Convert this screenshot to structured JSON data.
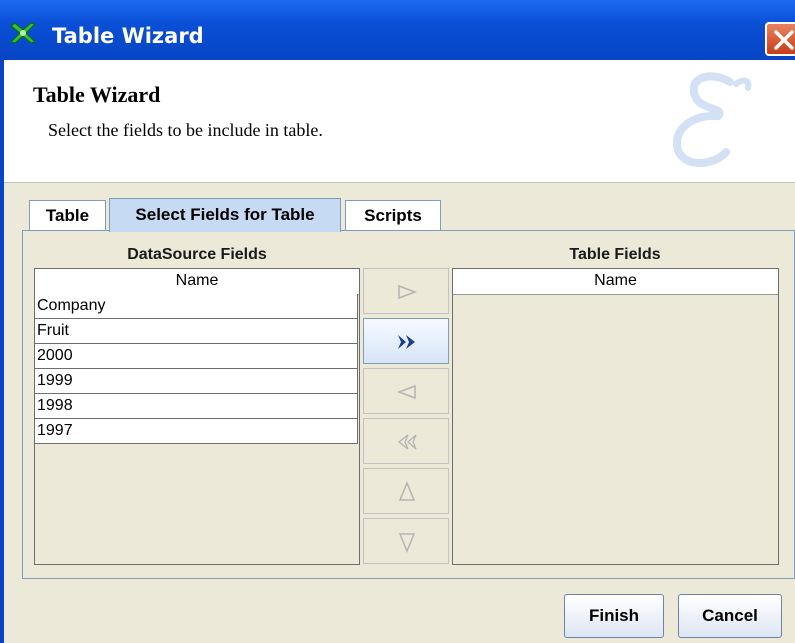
{
  "window": {
    "title": "Table Wizard",
    "icon": "wizard-icon",
    "close_icon": "close-icon"
  },
  "header": {
    "title": "Table Wizard",
    "subtitle": "Select the fields to be include in table.",
    "logo_icon": "E-logo-icon"
  },
  "tabs": [
    {
      "label": "Table",
      "selected": false
    },
    {
      "label": "Select Fields for Table",
      "selected": true
    },
    {
      "label": "Scripts",
      "selected": false
    }
  ],
  "datasource": {
    "label": "DataSource Fields",
    "column": "Name",
    "rows": [
      "Company",
      "Fruit",
      "2000",
      "1999",
      "1998",
      "1997"
    ]
  },
  "table_fields": {
    "label": "Table Fields",
    "column": "Name",
    "rows": []
  },
  "move_buttons": [
    {
      "icon": "move-right-icon",
      "enabled": false
    },
    {
      "icon": "move-all-right-icon",
      "enabled": true
    },
    {
      "icon": "move-left-icon",
      "enabled": false
    },
    {
      "icon": "move-all-left-icon",
      "enabled": false
    },
    {
      "icon": "move-up-icon",
      "enabled": false
    },
    {
      "icon": "move-down-icon",
      "enabled": false
    }
  ],
  "footer": {
    "finish": "Finish",
    "cancel": "Cancel"
  },
  "colors": {
    "title_bar": "#0a4fd6",
    "selected_tab": "#c7daf3",
    "dialog_bg": "#ece9d8",
    "border": "#7f9db9"
  }
}
